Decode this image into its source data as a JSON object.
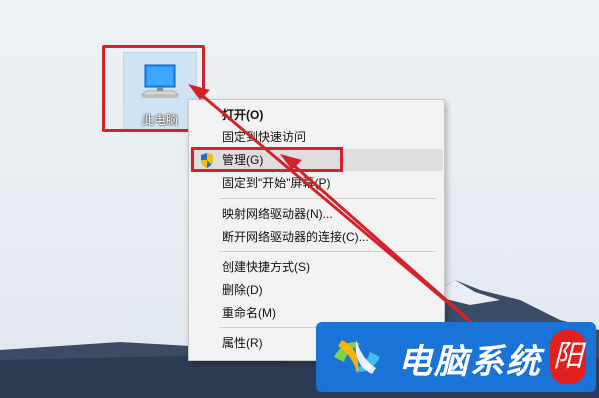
{
  "desktop": {
    "icon_label": "此电脑",
    "icon_name": "this-pc-icon"
  },
  "context_menu": {
    "items": [
      {
        "label": "打开(O)",
        "bold": true
      },
      {
        "label": "固定到快速访问"
      },
      {
        "label": "管理(G)",
        "highlighted": true,
        "icon": "uac-shield-icon"
      },
      {
        "label": "固定到\"开始\"屏幕(P)"
      },
      {
        "label": "映射网络驱动器(N)..."
      },
      {
        "label": "断开网络驱动器的连接(C)..."
      },
      {
        "label": "创建快捷方式(S)"
      },
      {
        "label": "删除(D)"
      },
      {
        "label": "重命名(M)"
      },
      {
        "label": "属性(R)"
      }
    ]
  },
  "watermark": {
    "text": "电脑系统",
    "badge": "阳"
  },
  "colors": {
    "annotation": "#d2232a",
    "brand_bg": "#1a73d6",
    "badge_bg": "#e32020"
  }
}
